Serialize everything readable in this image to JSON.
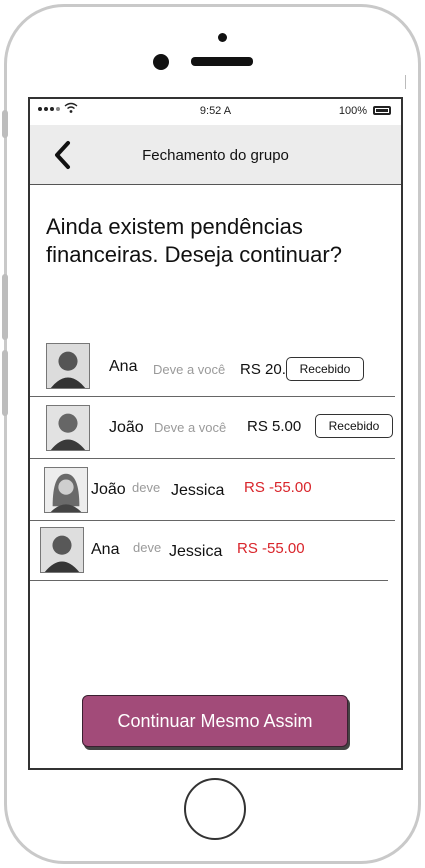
{
  "status_bar": {
    "time": "9:52 A",
    "battery": "100%"
  },
  "header": {
    "title": "Fechamento do grupo",
    "back_icon": "chevron-left-icon"
  },
  "question": "Ainda existem pendências financeiras. Deseja continuar?",
  "debts": [
    {
      "debtor": "Ana",
      "verb": "Deve a você",
      "amount": "RS 20.00",
      "button": "Recebido"
    },
    {
      "debtor": "João",
      "verb": "Deve a você",
      "amount": "RS 5.00",
      "button": "Recebido"
    },
    {
      "debtor": "João",
      "verb": "deve",
      "creditor": "Jessica",
      "amount": "RS -55.00"
    },
    {
      "debtor": "Ana",
      "verb": "deve",
      "creditor": "Jessica",
      "amount": "RS -55.00"
    }
  ],
  "continue_button": "Continuar Mesmo Assim",
  "colors": {
    "accent": "#a24b79",
    "negative_amount": "#d9252b",
    "muted_text": "#9a9a9a",
    "header_bg": "#ececec"
  }
}
